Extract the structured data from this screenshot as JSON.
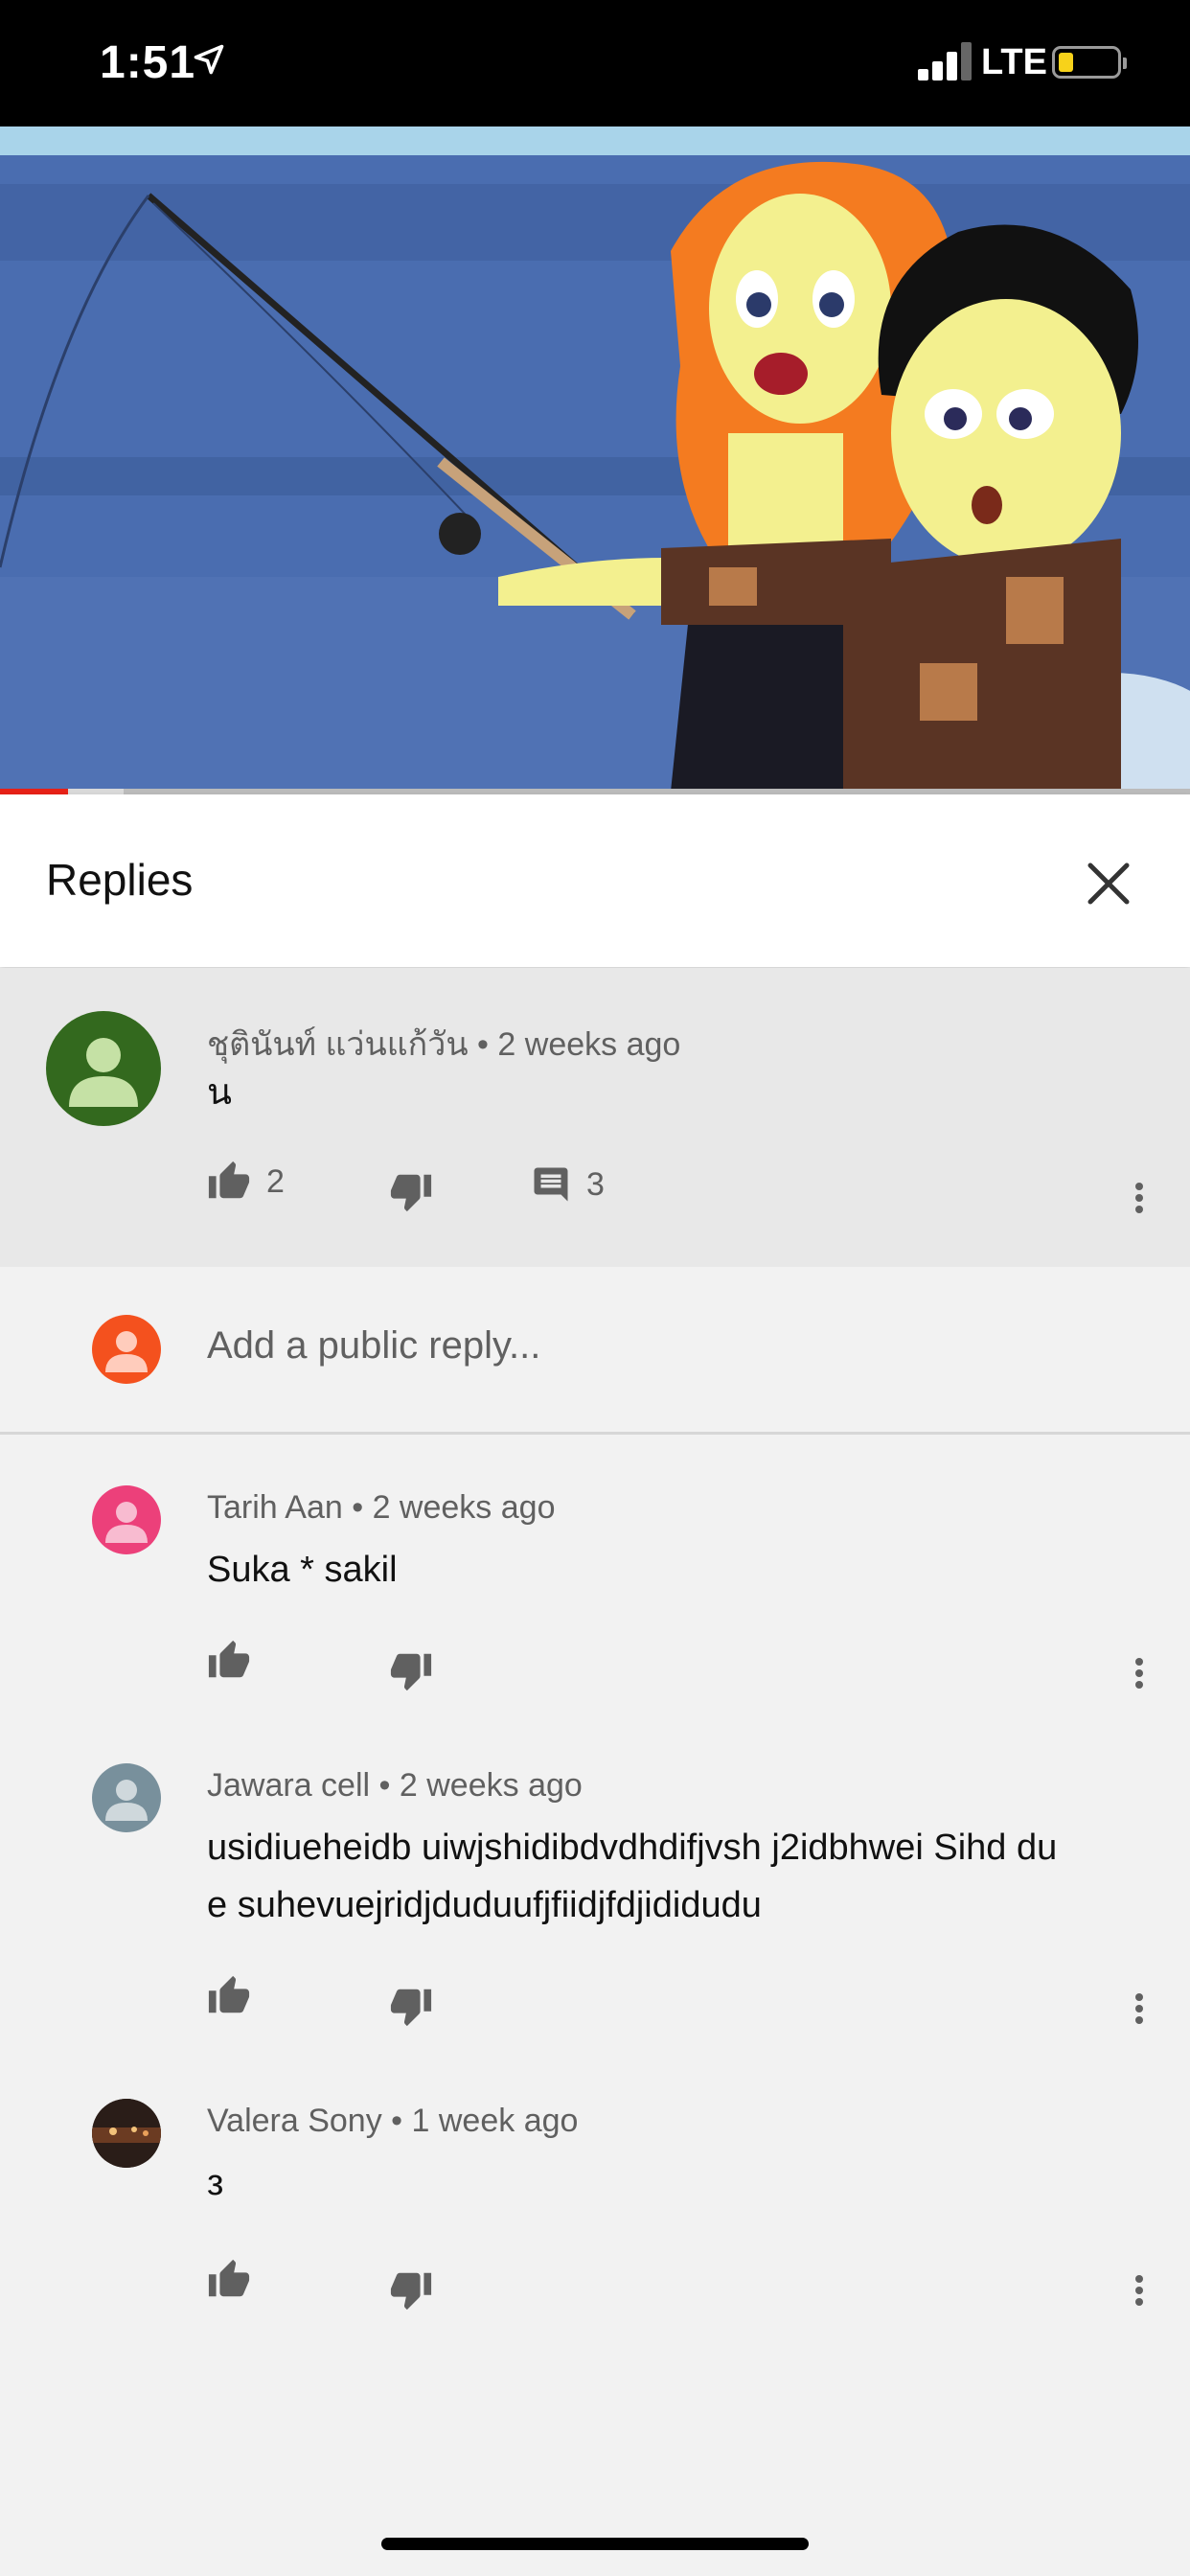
{
  "status_bar": {
    "time": "1:51",
    "network": "LTE"
  },
  "video": {
    "progress_fraction": 0.057,
    "buffer_fraction": 0.104
  },
  "replies_panel": {
    "title": "Replies"
  },
  "parent_comment": {
    "author": "ชุตินันท์ แว่นแก้วัน",
    "time": "2 weeks ago",
    "text": "น",
    "likes": "2",
    "reply_count": "3"
  },
  "add_reply": {
    "placeholder": "Add a public reply..."
  },
  "replies": [
    {
      "author": "Tarih Aan",
      "time": "2 weeks ago",
      "text": "Suka * sakil",
      "avatar_color": "#ec407a"
    },
    {
      "author": "Jawara cell",
      "time": "2 weeks ago",
      "text": "usidiueheidb uiwjshidibdvdhdifjvsh j2idbhwei Sihd du e suhevuejridjduduufjfiidjfdjididudu",
      "avatar_color": "#78909c"
    },
    {
      "author": "Valera Sony",
      "time": "1 week ago",
      "text": "з",
      "avatar_color": "#3a2a20"
    }
  ],
  "colors": {
    "accent_red": "#e62117",
    "add_reply_avatar": "#f4511e",
    "parent_avatar": "#33691e"
  },
  "icons": [
    "location-arrow-icon",
    "signal-icon",
    "battery-icon",
    "close-icon",
    "thumbs-up-icon",
    "thumbs-down-icon",
    "comment-icon",
    "more-vert-icon",
    "avatar-person-icon"
  ]
}
